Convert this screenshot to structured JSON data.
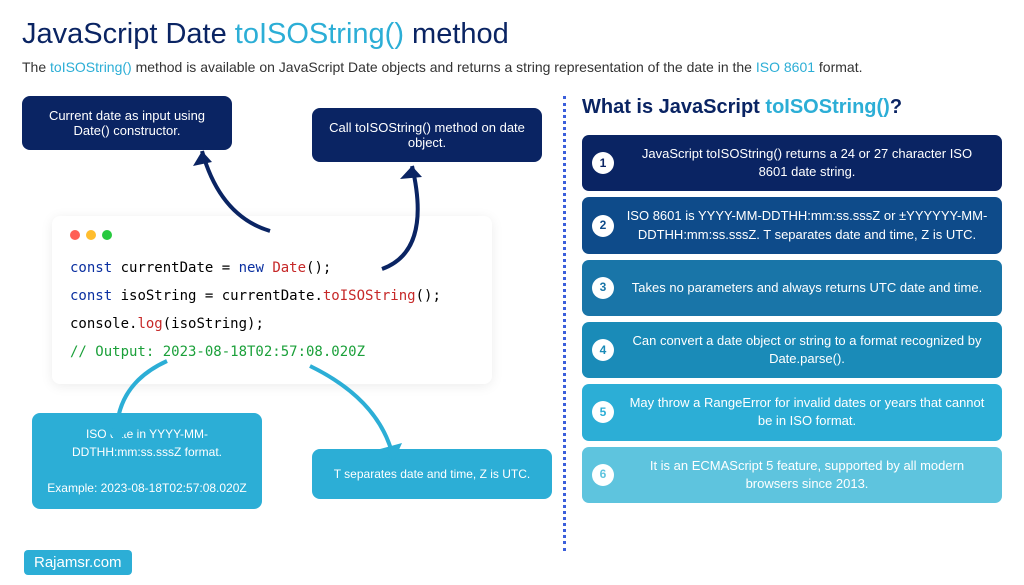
{
  "title": {
    "pre": "JavaScript Date ",
    "hl": "toISOString()",
    "post": " method"
  },
  "subtitle": {
    "pre": "The ",
    "hl1": "toISOString()",
    "mid": " method is available on JavaScript Date objects and returns a string representation of the date in the ",
    "hl2": "ISO 8601",
    "post": " format."
  },
  "callouts": {
    "c1": "Current date as input using Date() constructor.",
    "c2": "Call toISOString() method on date object.",
    "c3a": "ISO date in YYYY-MM-DDTHH:mm:ss.sssZ format.",
    "c3b": "Example: 2023-08-18T02:57:08.020Z",
    "c4": "T separates date and time, Z is UTC."
  },
  "code": {
    "l1": {
      "kw": "const",
      "txt": " currentDate = ",
      "nw": "new",
      "sp": " ",
      "cls": "Date",
      "end": "();"
    },
    "l2": {
      "kw": "const",
      "txt": " isoString = currentDate.",
      "fn": "toISOString",
      "end": "();"
    },
    "l3": {
      "obj": "console.",
      "fn": "log",
      "end": "(isoString);"
    },
    "l4": "// Output: 2023-08-18T02:57:08.020Z"
  },
  "watermark": {
    "a": "R",
    "b": "ajamsr.com"
  },
  "right_title": {
    "pre": "What is JavaScript ",
    "hl": "toISOString()",
    "post": "?"
  },
  "items": [
    "JavaScript toISOString() returns a 24 or 27 character ISO 8601 date string.",
    "ISO 8601 is YYYY-MM-DDTHH:mm:ss.sssZ or ±YYYYYY-MM-DDTHH:mm:ss.sssZ. T separates date and time, Z is UTC.",
    "Takes no parameters and always returns UTC date and time.",
    "Can convert a date object or string to a format recognized by Date.parse().",
    "May throw a RangeError for invalid dates or years that cannot be in ISO format.",
    "It is an ECMAScript 5 feature, supported by all modern browsers since 2013."
  ]
}
